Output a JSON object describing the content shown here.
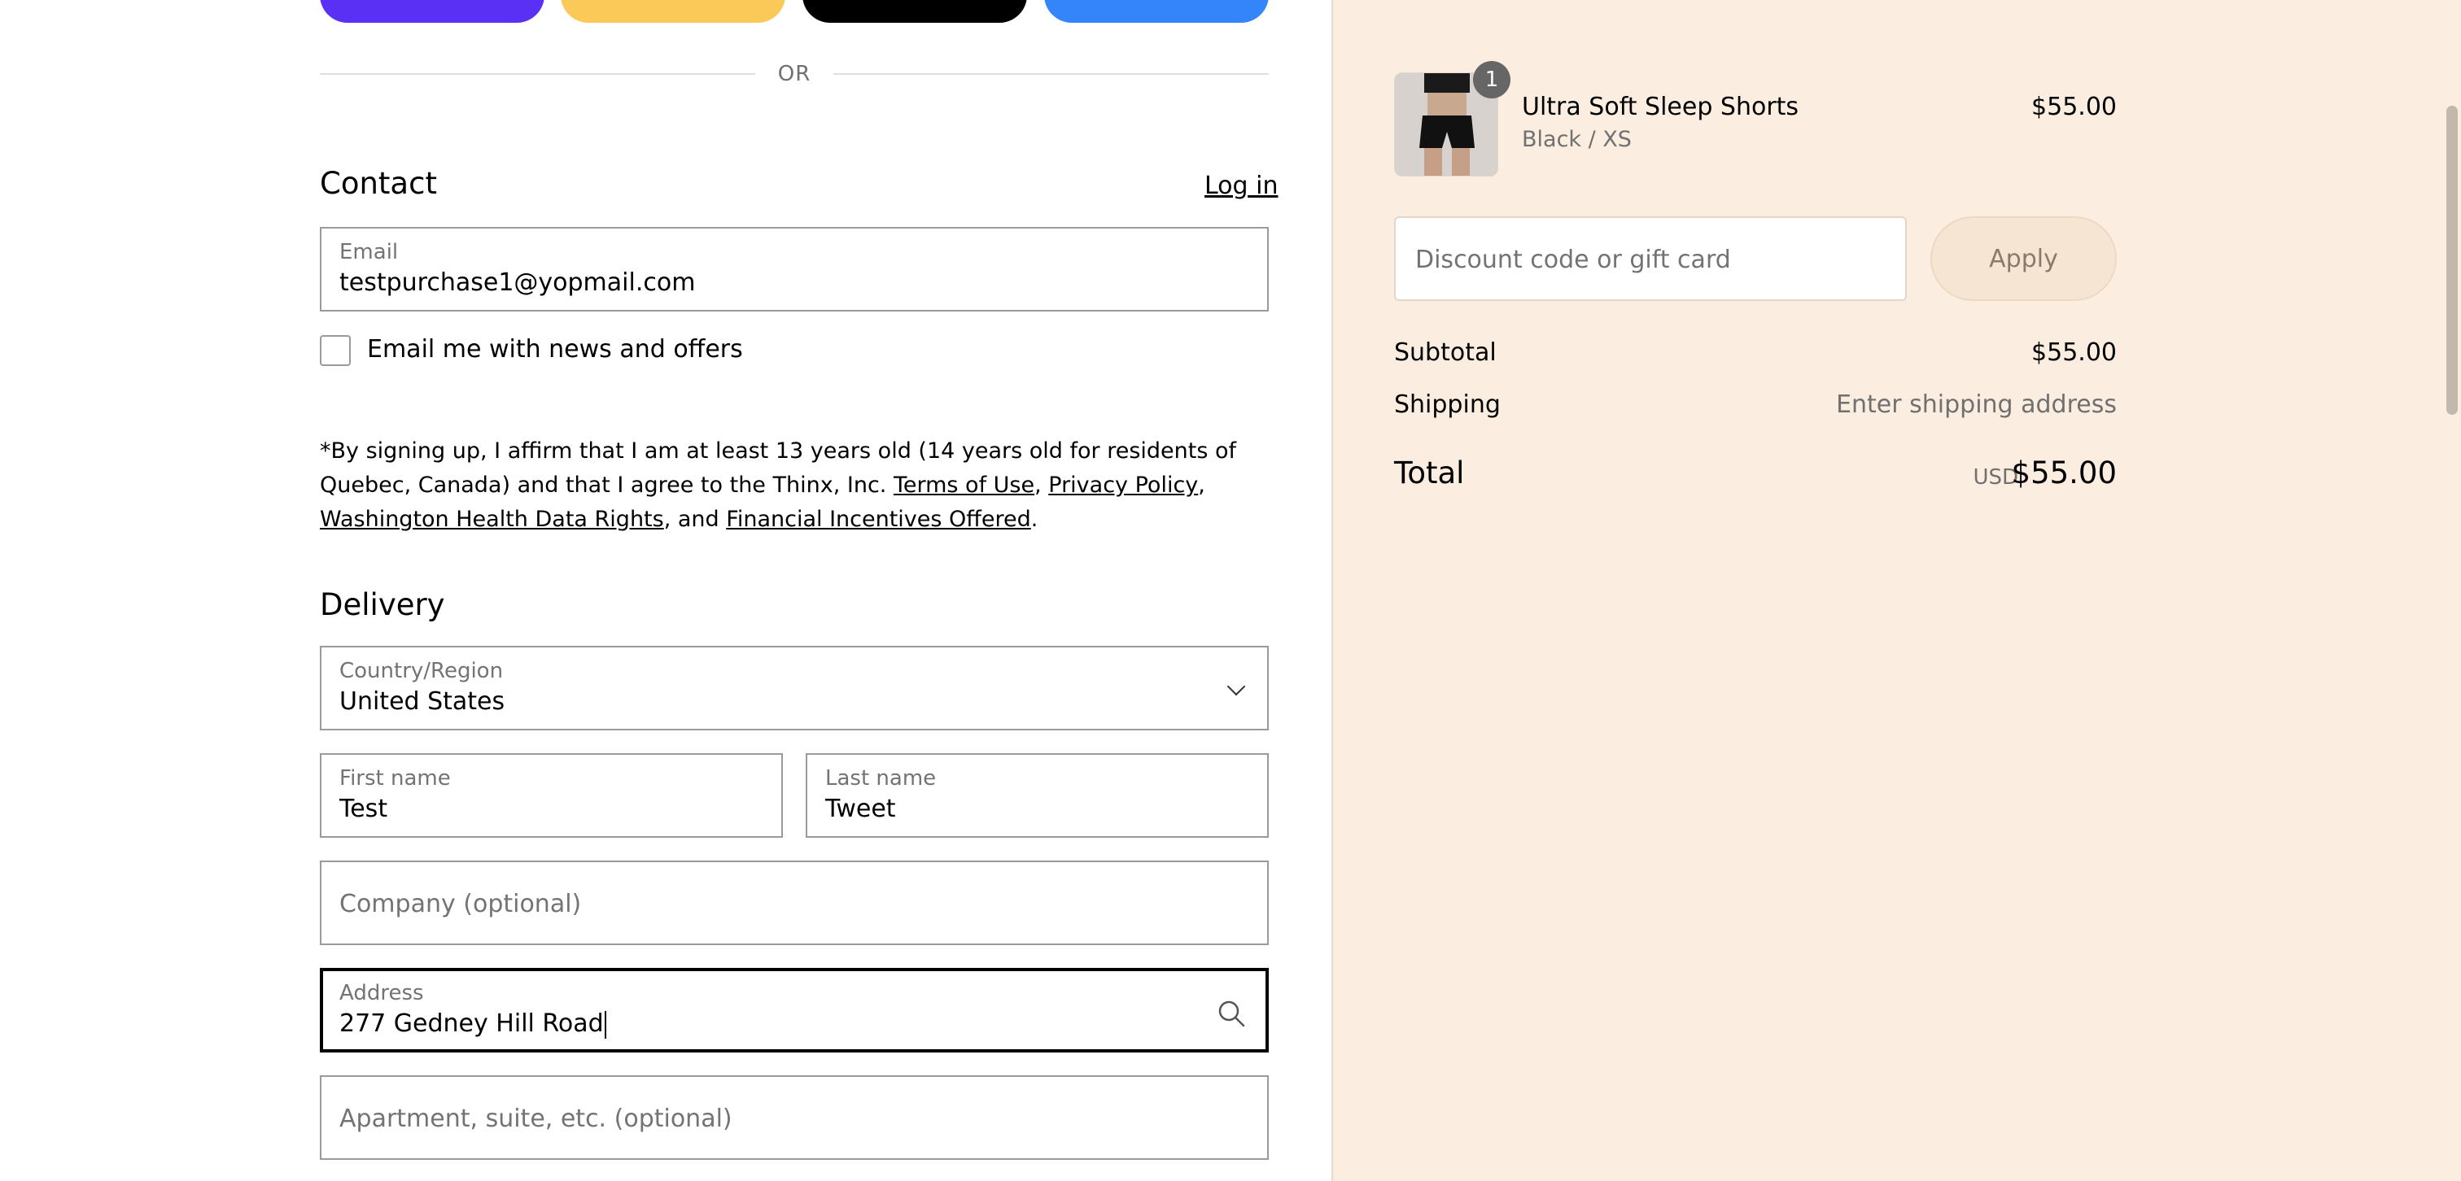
{
  "express": {
    "divider_text": "OR"
  },
  "contact": {
    "heading": "Contact",
    "login_link": "Log in",
    "email_label": "Email",
    "email_value": "testpurchase1@yopmail.com",
    "newsletter_label": "Email me with news and offers"
  },
  "legal": {
    "text_1": "*By signing up, I affirm that I am at least 13 years old (14 years old for residents of Quebec, Canada) and that I agree to the Thinx, Inc. ",
    "terms": "Terms of Use",
    "sep_1": ", ",
    "privacy": "Privacy Policy",
    "sep_2": ", ",
    "health": "Washington Health Data Rights",
    "sep_3": ", and ",
    "incentives": "Financial Incentives Offered",
    "end": "."
  },
  "delivery": {
    "heading": "Delivery",
    "country_label": "Country/Region",
    "country_value": "United States",
    "first_name_label": "First name",
    "first_name_value": "Test",
    "last_name_label": "Last name",
    "last_name_value": "Tweet",
    "company_placeholder": "Company (optional)",
    "address_label": "Address",
    "address_value": "277 Gedney Hill Road",
    "apartment_placeholder": "Apartment, suite, etc. (optional)"
  },
  "summary": {
    "product": {
      "name": "Ultra Soft Sleep Shorts",
      "variant": "Black / XS",
      "price": "$55.00",
      "quantity": "1"
    },
    "discount_placeholder": "Discount code or gift card",
    "apply_label": "Apply",
    "subtotal_label": "Subtotal",
    "subtotal_value": "$55.00",
    "shipping_label": "Shipping",
    "shipping_value": "Enter shipping address",
    "total_label": "Total",
    "total_currency": "USD",
    "total_value": "$55.00"
  },
  "icons": {
    "country_dropdown": "chevron-down-icon",
    "address_search": "search-icon"
  },
  "colors": {
    "summary_background": "#fbeee0",
    "shop_pay": "#5a31f4",
    "paypal": "#fbc957",
    "apple_pay": "#000000",
    "google_pay": "#3485fa"
  }
}
